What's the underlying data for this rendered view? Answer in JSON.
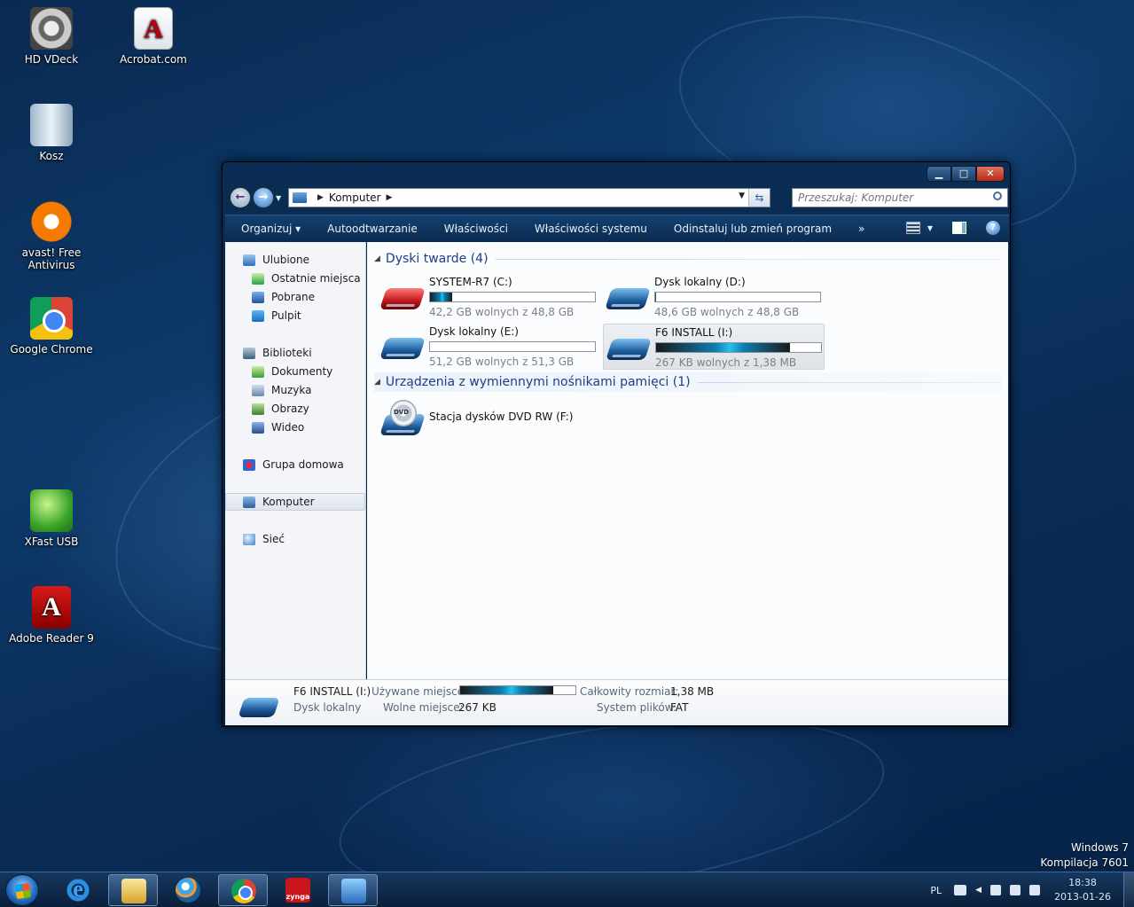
{
  "desktop": {
    "icons": [
      {
        "label": "HD VDeck"
      },
      {
        "label": "Acrobat.com"
      },
      {
        "label": "Kosz"
      },
      {
        "label": "avast! Free Antivirus"
      },
      {
        "label": "Google Chrome"
      },
      {
        "label": "XFast USB"
      },
      {
        "label": "Adobe Reader 9"
      }
    ],
    "watermark": {
      "line1": "Windows 7",
      "line2": "Kompilacja 7601"
    }
  },
  "window": {
    "caption_buttons": {
      "minimize": "▁",
      "maximize": "□",
      "close": "✕"
    },
    "address": {
      "crumb": "Komputer",
      "sep": "▶"
    },
    "search": {
      "placeholder": "Przeszukaj: Komputer"
    },
    "commands": [
      "Organizuj ▾",
      "Autoodtwarzanie",
      "Właściwości",
      "Właściwości systemu",
      "Odinstaluj lub zmień program",
      "»"
    ],
    "nav": {
      "favorites": "Ulubione",
      "recent": "Ostatnie miejsca",
      "downloads": "Pobrane",
      "desktop": "Pulpit",
      "libraries": "Biblioteki",
      "documents": "Dokumenty",
      "music": "Muzyka",
      "pictures": "Obrazy",
      "videos": "Wideo",
      "homegroup": "Grupa domowa",
      "computer": "Komputer",
      "network": "Sieć"
    },
    "groups": {
      "hard_disks": "Dyski twarde (4)",
      "removable": "Urządzenia z wymiennymi nośnikami pamięci (1)"
    },
    "drives": [
      {
        "name": "SYSTEM-R7 (C:)",
        "free": "42,2 GB wolnych z 48,8 GB",
        "used_fraction": 0.135
      },
      {
        "name": "Dysk lokalny (D:)",
        "free": "48,6 GB wolnych z 48,8 GB",
        "used_fraction": 0.004
      },
      {
        "name": "Dysk lokalny (E:)",
        "free": "51,2 GB wolnych z 51,3 GB",
        "used_fraction": 0.002
      },
      {
        "name": "F6 INSTALL (I:)",
        "free": "267 KB wolnych z 1,38 MB",
        "used_fraction": 0.81
      }
    ],
    "dvd": {
      "name": "Stacja dysków DVD RW (F:)",
      "disc_label": "DVD"
    },
    "details": {
      "name": "F6 INSTALL (I:)",
      "type": "Dysk lokalny",
      "used_label": "Używane miejsce:",
      "used_fraction": 0.81,
      "free_label": "Wolne miejsce:",
      "free_value": "267 KB",
      "total_label": "Całkowity rozmiar:",
      "total_value": "1,38 MB",
      "fs_label": "System plików:",
      "fs_value": "FAT"
    }
  },
  "taskbar": {
    "language": "PL",
    "time": "18:38",
    "date": "2013-01-26",
    "zynga_label": "zynga"
  }
}
